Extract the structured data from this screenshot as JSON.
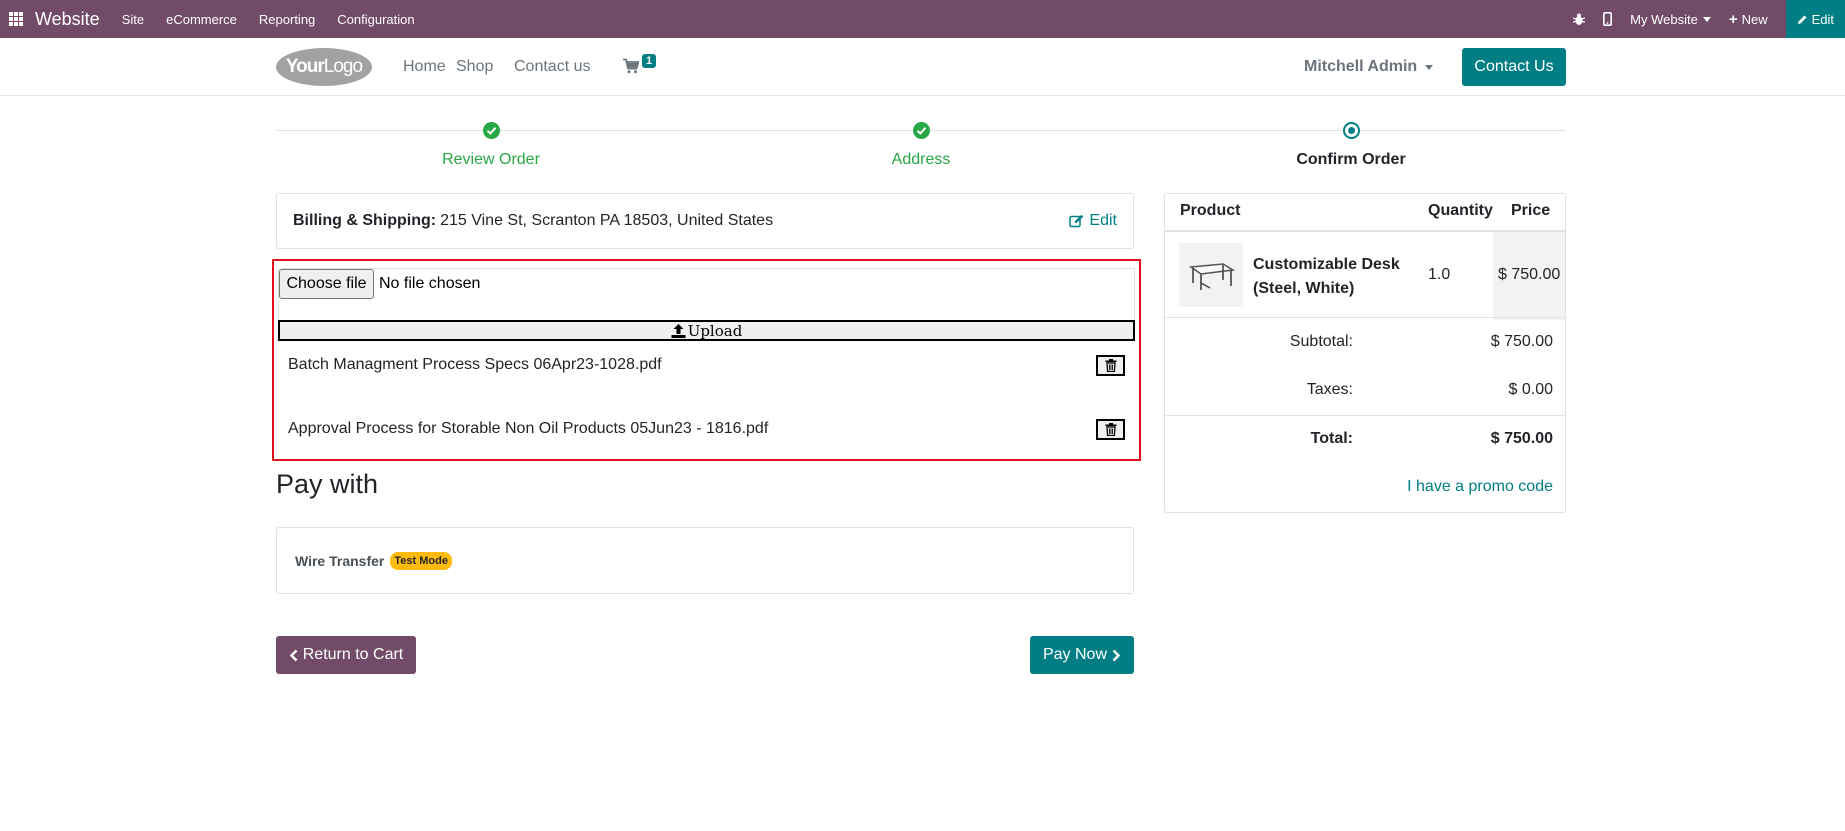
{
  "adminbar": {
    "brand": "Website",
    "menus": [
      "Site",
      "eCommerce",
      "Reporting",
      "Configuration"
    ],
    "website_selector": "My Website",
    "new_label": "New",
    "edit_label": "Edit"
  },
  "header": {
    "logo_bold": "Your",
    "logo_light": "Logo",
    "nav": [
      "Home",
      "Shop",
      "Contact us"
    ],
    "cart_count": "1",
    "user": "Mitchell Admin",
    "cta": "Contact Us"
  },
  "steps": [
    {
      "label": "Review Order",
      "status": "done"
    },
    {
      "label": "Address",
      "status": "done"
    },
    {
      "label": "Confirm Order",
      "status": "current"
    }
  ],
  "billing": {
    "label": "Billing & Shipping:",
    "address": "215 Vine St, Scranton PA 18503, United States",
    "edit": "Edit"
  },
  "upload": {
    "choose_label": "Choose file",
    "status": "No file chosen",
    "upload_label": "Upload",
    "files": [
      "Batch Managment Process Specs 06Apr23-1028.pdf",
      "Approval Process for Storable Non Oil Products 05Jun23 - 1816.pdf"
    ]
  },
  "payment": {
    "title": "Pay with",
    "method": "Wire Transfer",
    "badge": "Test Mode"
  },
  "buttons": {
    "back": "Return to Cart",
    "pay": "Pay Now"
  },
  "summary": {
    "headers": {
      "product": "Product",
      "quantity": "Quantity",
      "price": "Price"
    },
    "item": {
      "name": "Customizable Desk (Steel, White)",
      "quantity": "1.0",
      "price": "$ 750.00"
    },
    "subtotal_label": "Subtotal:",
    "subtotal": "$ 750.00",
    "taxes_label": "Taxes:",
    "taxes": "$ 0.00",
    "total_label": "Total:",
    "total": "$ 750.00",
    "promo": "I have a promo code"
  },
  "colors": {
    "admin_bar": "#714b67",
    "primary": "#017e84",
    "success": "#28a745",
    "highlight_border": "#e0101f",
    "badge": "#ffbb0b"
  }
}
